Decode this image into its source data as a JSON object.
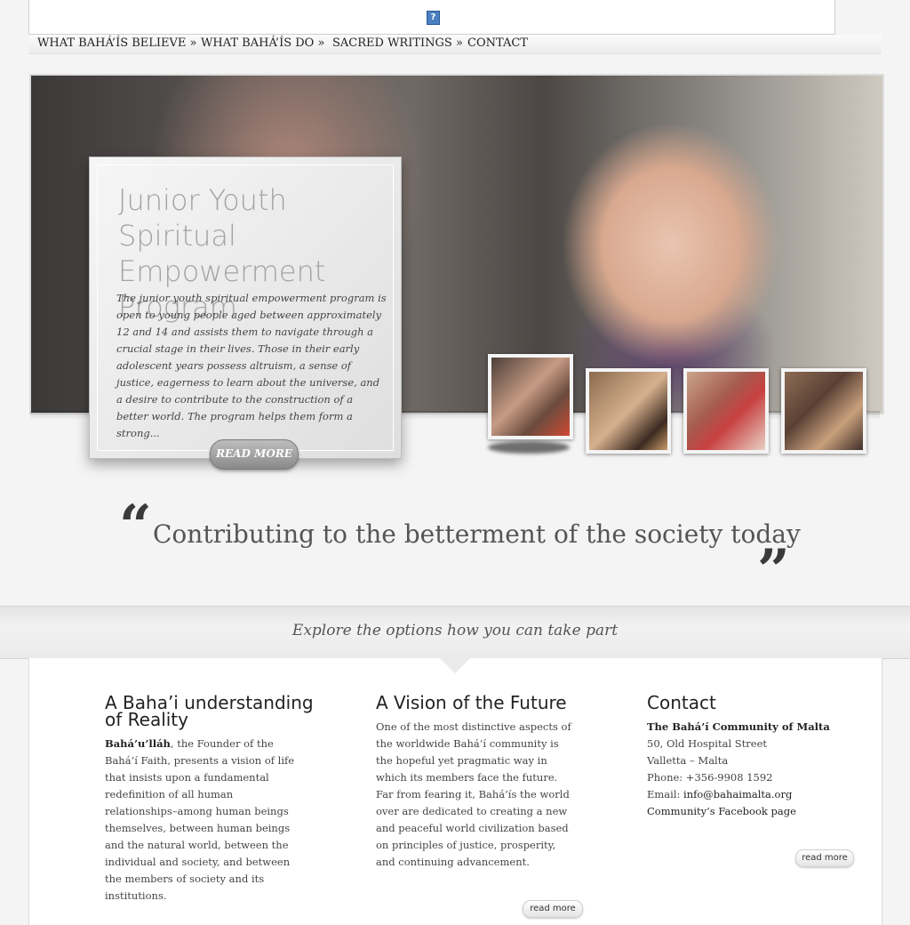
{
  "header": {
    "logo_placeholder": "?"
  },
  "nav": {
    "items": [
      {
        "label": "WHAT BAHÁ’ÍS BELIEVE »"
      },
      {
        "label": "WHAT BAHÁ’ÍS DO »"
      },
      {
        "label": "SACRED WRITINGS »"
      },
      {
        "label": "CONTACT"
      }
    ]
  },
  "slider": {
    "title": "Junior Youth Spiritual Empowerment Program",
    "text": "The junior youth spiritual empowerment program is open to young people aged between approximately 12 and 14 and assists them to navigate through a crucial stage in their lives. Those in their early adolescent years possess altruism, a sense of justice, eagerness to learn about the universe, and a desire to contribute to the construction of a better world. The program helps them form a strong...",
    "read_more": "READ MORE",
    "thumbnails_count": 4
  },
  "quote": {
    "open": "“",
    "text": "Contributing to the betterment of the society today",
    "close": "”"
  },
  "explore": {
    "text": "Explore the options how you can take part"
  },
  "columns": {
    "reality": {
      "title_line1": "A Baha’i understanding",
      "title_line2": "of Reality",
      "bold": "Bahá’u’lláh",
      "text": ", the Founder of the Bahá’í Faith, presents a vision of life that insists upon a fundamental redefinition of all human relationships–among human beings themselves, between human beings and the natural world, between the individual and society, and between the members of society and its institutions.",
      "read_more": "read more"
    },
    "vision": {
      "title": "A Vision of the Future",
      "text": "One of the most distinctive aspects of the worldwide Bahá’í community is the hopeful yet pragmatic way in which its members face the future. Far from fearing it, Bahá’ís the world over are dedicated to creating a new and peaceful world civilization based on principles of justice, prosperity, and continuing advancement.",
      "read_more": "read more"
    },
    "contact": {
      "title": "Contact",
      "org": "The Bahá’í Community of Malta",
      "address1": "50, Old Hospital Street",
      "address2": "Valletta – Malta",
      "phone": "Phone: +356-9908 1592",
      "email_label": "Email: ",
      "email": "info@bahaimalta.org",
      "facebook": "Community’s Facebook page",
      "read_more": "read more"
    }
  }
}
